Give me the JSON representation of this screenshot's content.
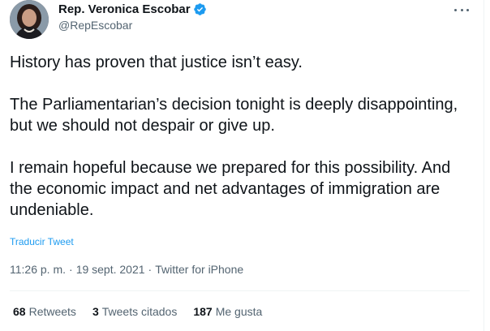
{
  "author": {
    "name": "Rep. Veronica Escobar",
    "handle": "@RepEscobar",
    "verified_color": "#1d9bf0"
  },
  "tweet": {
    "paragraphs": [
      "History has proven that justice isn’t easy.",
      "The Parliamentarian’s decision tonight is deeply disappointing, but we should not despair or give up.",
      "I remain hopeful because we prepared for this possibility. And the economic impact and net advantages of immigration are undeniable."
    ],
    "translate_label": "Traducir Tweet"
  },
  "meta": {
    "time": "11:26 p. m.",
    "separator": "·",
    "date": "19 sept. 2021",
    "source": "Twitter for iPhone"
  },
  "stats": [
    {
      "count": "68",
      "label": "Retweets"
    },
    {
      "count": "3",
      "label": "Tweets citados"
    },
    {
      "count": "187",
      "label": "Me gusta"
    }
  ],
  "icons": {
    "more": "more-horizontal-icon",
    "verified": "verified-badge-icon"
  }
}
